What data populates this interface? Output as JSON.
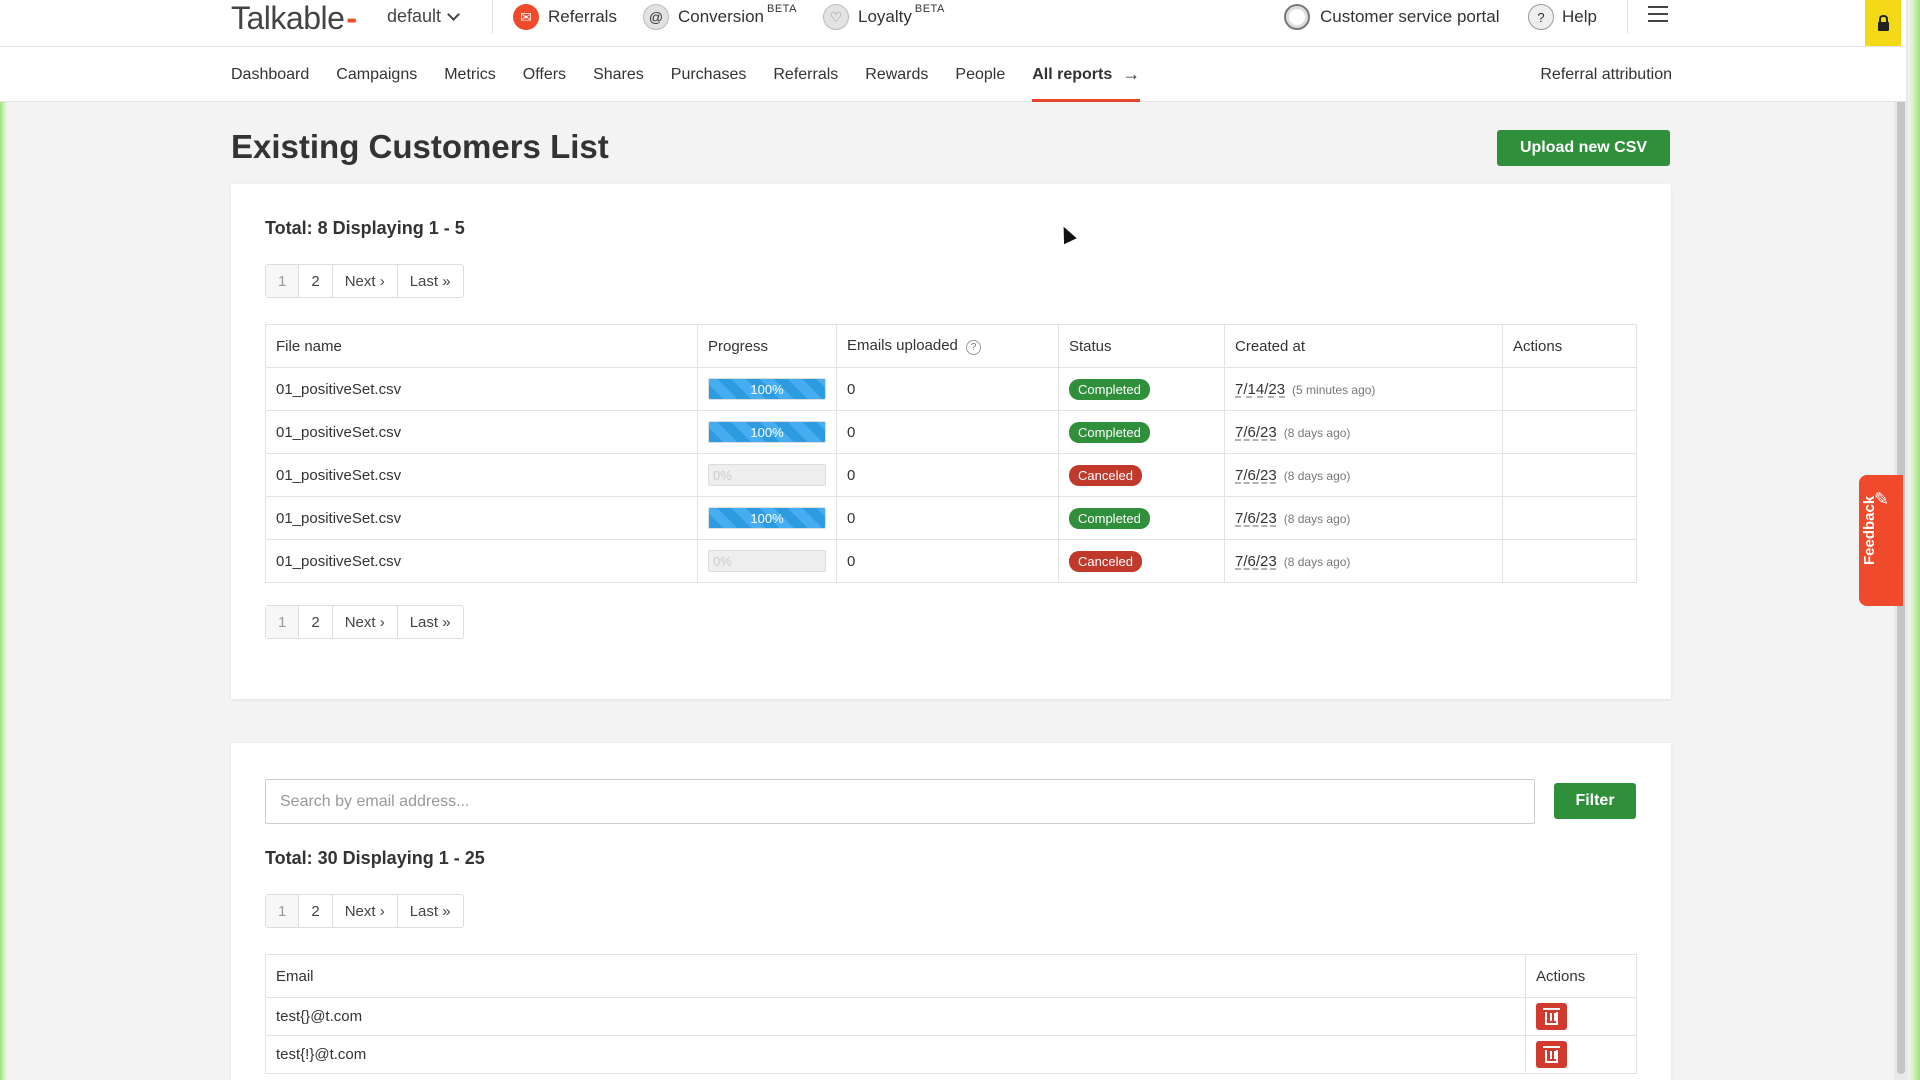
{
  "topbar": {
    "logo": "Talkable",
    "site": "default",
    "products": [
      {
        "label": "Referrals",
        "beta": ""
      },
      {
        "label": "Conversion",
        "beta": "BETA"
      },
      {
        "label": "Loyalty",
        "beta": "BETA"
      }
    ],
    "customer_service": "Customer service portal",
    "help": "Help"
  },
  "nav": {
    "items": [
      "Dashboard",
      "Campaigns",
      "Metrics",
      "Offers",
      "Shares",
      "Purchases",
      "Referrals",
      "Rewards",
      "People",
      "All reports"
    ],
    "active": "All reports",
    "right": "Referral attribution"
  },
  "page": {
    "title": "Existing Customers List",
    "upload_button": "Upload new CSV"
  },
  "uploads": {
    "total": "Total: 8 Displaying 1 - 5",
    "pager": [
      "1",
      "2",
      "Next ›",
      "Last »"
    ],
    "columns": [
      "File name",
      "Progress",
      "Emails uploaded",
      "Status",
      "Created at",
      "Actions"
    ],
    "rows": [
      {
        "file": "01_positiveSet.csv",
        "progress": 100,
        "progress_label": "100%",
        "emails": "0",
        "status": "Completed",
        "date": "7/14/23",
        "ago": "(5 minutes ago)"
      },
      {
        "file": "01_positiveSet.csv",
        "progress": 100,
        "progress_label": "100%",
        "emails": "0",
        "status": "Completed",
        "date": "7/6/23",
        "ago": "(8 days ago)"
      },
      {
        "file": "01_positiveSet.csv",
        "progress": 0,
        "progress_label": "0%",
        "emails": "0",
        "status": "Canceled",
        "date": "7/6/23",
        "ago": "(8 days ago)"
      },
      {
        "file": "01_positiveSet.csv",
        "progress": 100,
        "progress_label": "100%",
        "emails": "0",
        "status": "Completed",
        "date": "7/6/23",
        "ago": "(8 days ago)"
      },
      {
        "file": "01_positiveSet.csv",
        "progress": 0,
        "progress_label": "0%",
        "emails": "0",
        "status": "Canceled",
        "date": "7/6/23",
        "ago": "(8 days ago)"
      }
    ]
  },
  "emails": {
    "search_placeholder": "Search by email address...",
    "filter_button": "Filter",
    "total": "Total: 30 Displaying 1 - 25",
    "pager": [
      "1",
      "2",
      "Next ›",
      "Last »"
    ],
    "columns": [
      "Email",
      "Actions"
    ],
    "rows": [
      "test{}@t.com",
      "test{!}@t.com"
    ]
  },
  "feedback": "Feedback"
}
